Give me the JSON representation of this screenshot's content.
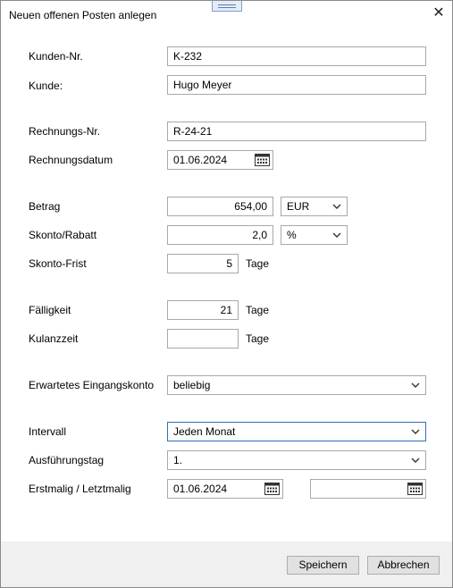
{
  "window": {
    "title": "Neuen offenen Posten anlegen"
  },
  "form": {
    "kunden_nr": {
      "label": "Kunden-Nr.",
      "value": "K-232"
    },
    "kunde": {
      "label": "Kunde:",
      "value": "Hugo Meyer"
    },
    "rechnungs_nr": {
      "label": "Rechnungs-Nr.",
      "value": "R-24-21"
    },
    "rechnungsdatum": {
      "label": "Rechnungsdatum",
      "value": "01.06.2024"
    },
    "betrag": {
      "label": "Betrag",
      "value": "654,00",
      "currency": "EUR"
    },
    "skonto": {
      "label": "Skonto/Rabatt",
      "value": "2,0",
      "unit": "%"
    },
    "skonto_frist": {
      "label": "Skonto-Frist",
      "value": "5",
      "unit": "Tage"
    },
    "faelligkeit": {
      "label": "Fälligkeit",
      "value": "21",
      "unit": "Tage"
    },
    "kulanzzeit": {
      "label": "Kulanzzeit",
      "value": "",
      "unit": "Tage"
    },
    "eingangskonto": {
      "label": "Erwartetes Eingangskonto",
      "value": "beliebig"
    },
    "intervall": {
      "label": "Intervall",
      "value": "Jeden Monat"
    },
    "ausfuehrungstag": {
      "label": "Ausführungstag",
      "value": "1."
    },
    "erst_letzt": {
      "label": "Erstmalig / Letztmalig",
      "first": "01.06.2024",
      "last": ""
    }
  },
  "footer": {
    "save_label": "Speichern",
    "cancel_label": "Abbrechen"
  },
  "icons": {
    "close": "close-icon",
    "calendar": "calendar-icon",
    "dropdown": "chevron-down-icon"
  },
  "colors": {
    "focus_border": "#2f6fb6",
    "footer_bg": "#f0f0f0"
  }
}
